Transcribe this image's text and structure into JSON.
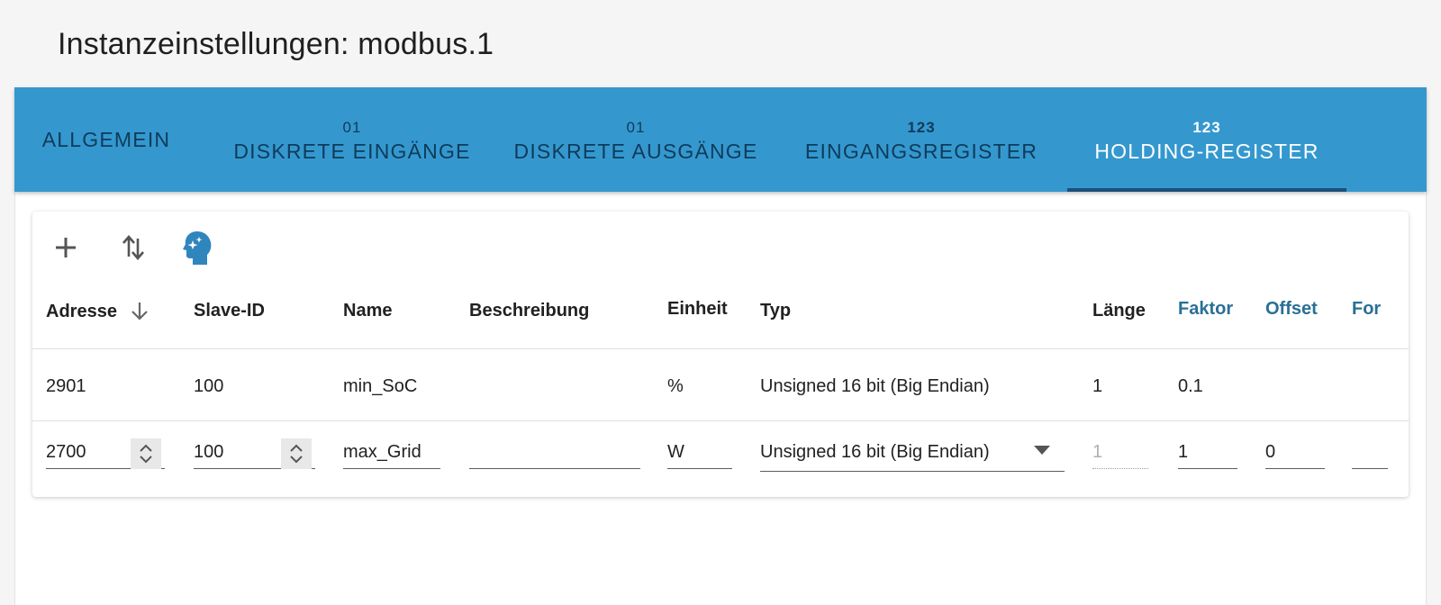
{
  "window": {
    "title": "Instanzeinstellungen: modbus.1"
  },
  "tabs": [
    {
      "icon": "",
      "label": "ALLGEMEIN"
    },
    {
      "icon": "01",
      "label": "DISKRETE EINGÄNGE"
    },
    {
      "icon": "01",
      "label": "DISKRETE AUSGÄNGE"
    },
    {
      "icon": "123",
      "label": "EINGANGSREGISTER"
    },
    {
      "icon": "123",
      "label": "HOLDING-REGISTER"
    }
  ],
  "active_tab": "HOLDING-REGISTER",
  "toolbar": {
    "icons": [
      "plus-icon",
      "sort-arrows-icon",
      "ai-head-icon"
    ]
  },
  "table": {
    "headers": [
      "Adresse",
      "Slave-ID",
      "Name",
      "Beschreibung",
      "Einheit",
      "Typ",
      "Länge",
      "Faktor",
      "Offset",
      "For"
    ],
    "rows": [
      {
        "adresse": "2901",
        "slave_id": "100",
        "name": "min_SoC",
        "beschreibung": "",
        "einheit": "%",
        "typ": "Unsigned 16 bit (Big Endian)",
        "laenge": "1",
        "faktor": "0.1",
        "offset": ""
      },
      {
        "adresse": "2700",
        "slave_id": "100",
        "name": "max_Grid",
        "beschreibung": "",
        "einheit": "W",
        "typ": "Unsigned 16 bit (Big Endian)",
        "laenge": "1",
        "faktor": "1",
        "offset": "0"
      }
    ]
  },
  "colors": {
    "tab_bar": "#3498cf",
    "accent_header": "#2a6f95",
    "active_tab_text": "#ffffff",
    "inactive_tab_text": "#0f3b5a"
  }
}
